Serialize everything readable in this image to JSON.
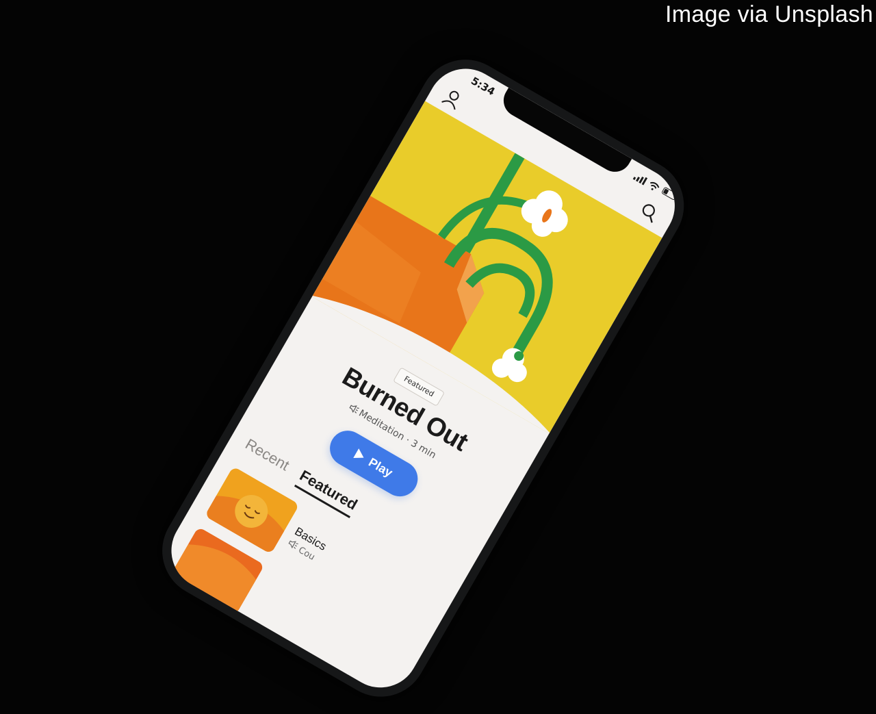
{
  "credit": "Image via Unsplash",
  "status_bar": {
    "time": "5:34"
  },
  "icons": {
    "profile": "person-icon",
    "search": "search-icon",
    "signal": "signal-icon",
    "wifi": "wifi-icon",
    "battery": "battery-icon",
    "play": "play-icon",
    "audio": "speaker-icon"
  },
  "featured": {
    "badge": "Featured",
    "title": "Burned Out",
    "meta": "Meditation · 3 min",
    "play_label": "Play"
  },
  "tabs": [
    {
      "label": "Recent",
      "active": false
    },
    {
      "label": "Featured",
      "active": true
    }
  ],
  "list": [
    {
      "title": "Basics",
      "subtitle": "Cou"
    },
    {
      "title": "",
      "subtitle": ""
    }
  ],
  "colors": {
    "hero_yellow": "#e9cc2a",
    "accent_orange": "#e8751a",
    "stem_green": "#2b9a45",
    "play_blue": "#3f7ae8",
    "screen_bg": "#f4f2f0",
    "background": "#040404"
  }
}
